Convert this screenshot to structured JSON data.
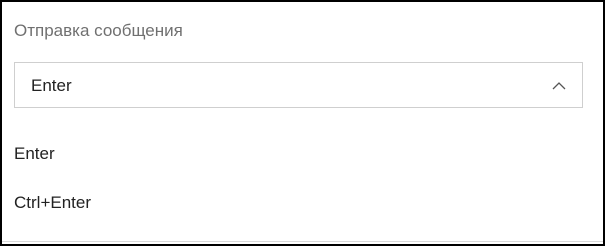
{
  "field": {
    "label": "Отправка сообщения",
    "selected_value": "Enter",
    "icon": "chevron-up-icon",
    "expanded": true
  },
  "dropdown": {
    "options": [
      {
        "label": "Enter"
      },
      {
        "label": "Ctrl+Enter"
      }
    ]
  },
  "colors": {
    "label_text": "#707070",
    "text": "#222222",
    "border": "#cfcfcf",
    "frame_border": "#000000"
  }
}
